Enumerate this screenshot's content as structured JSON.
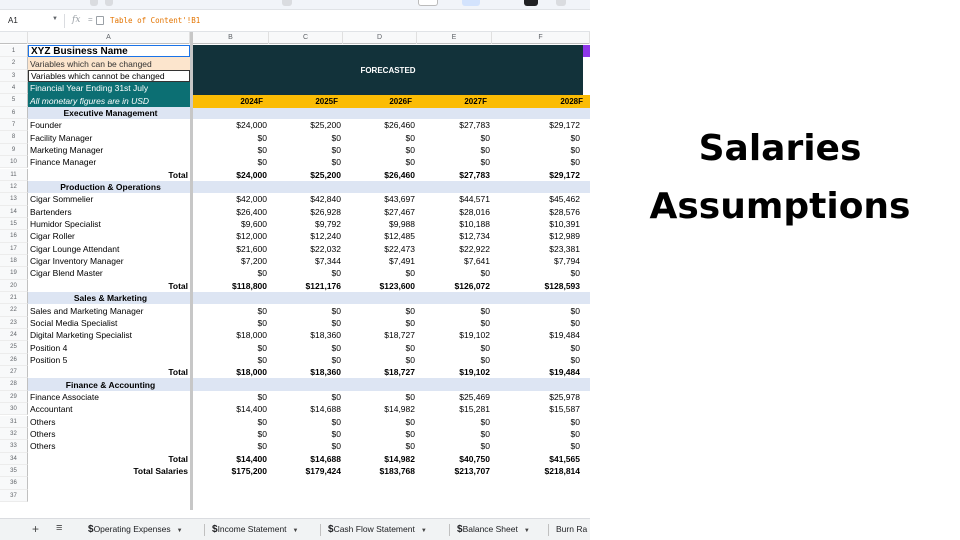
{
  "slide": {
    "title_line1": "Salaries",
    "title_line2": "Assumptions"
  },
  "formula_bar": {
    "cell_ref": "A1",
    "formula": "Table of Content'!B1"
  },
  "columns": [
    "A",
    "B",
    "C",
    "D",
    "E",
    "F"
  ],
  "header_block": {
    "forecast_label": "FORECASTED",
    "years": [
      "2024F",
      "2025F",
      "2026F",
      "2027F",
      "2028F"
    ]
  },
  "rows": [
    {
      "n": "1",
      "a": "XYZ Business Name",
      "style": "title"
    },
    {
      "n": "2",
      "a": "Variables which can be changed",
      "style": "peach"
    },
    {
      "n": "3",
      "a": "Variables which cannot be changed",
      "style": "white-box"
    },
    {
      "n": "4",
      "a": "Financial Year Ending 31st July",
      "style": "teal"
    },
    {
      "n": "5",
      "a": "All monetary figures are in USD",
      "style": "teal-italic"
    },
    {
      "n": "6",
      "a": "Executive Management",
      "style": "section"
    },
    {
      "n": "7",
      "a": "Founder",
      "v": [
        "$24,000",
        "$25,200",
        "$26,460",
        "$27,783",
        "$29,172"
      ]
    },
    {
      "n": "8",
      "a": "Facility Manager",
      "v": [
        "$0",
        "$0",
        "$0",
        "$0",
        "$0"
      ]
    },
    {
      "n": "9",
      "a": "Marketing Manager",
      "v": [
        "$0",
        "$0",
        "$0",
        "$0",
        "$0"
      ]
    },
    {
      "n": "10",
      "a": "Finance Manager",
      "v": [
        "$0",
        "$0",
        "$0",
        "$0",
        "$0"
      ]
    },
    {
      "n": "11",
      "a": "Total",
      "style": "total",
      "v": [
        "$24,000",
        "$25,200",
        "$26,460",
        "$27,783",
        "$29,172"
      ]
    },
    {
      "n": "12",
      "a": "Production & Operations",
      "style": "section"
    },
    {
      "n": "13",
      "a": "Cigar Sommelier",
      "v": [
        "$42,000",
        "$42,840",
        "$43,697",
        "$44,571",
        "$45,462"
      ]
    },
    {
      "n": "14",
      "a": "Bartenders",
      "v": [
        "$26,400",
        "$26,928",
        "$27,467",
        "$28,016",
        "$28,576"
      ]
    },
    {
      "n": "15",
      "a": "Humidor Specialist",
      "v": [
        "$9,600",
        "$9,792",
        "$9,988",
        "$10,188",
        "$10,391"
      ]
    },
    {
      "n": "16",
      "a": "Cigar Roller",
      "v": [
        "$12,000",
        "$12,240",
        "$12,485",
        "$12,734",
        "$12,989"
      ]
    },
    {
      "n": "17",
      "a": "Cigar Lounge Attendant",
      "v": [
        "$21,600",
        "$22,032",
        "$22,473",
        "$22,922",
        "$23,381"
      ]
    },
    {
      "n": "18",
      "a": "Cigar Inventory Manager",
      "v": [
        "$7,200",
        "$7,344",
        "$7,491",
        "$7,641",
        "$7,794"
      ]
    },
    {
      "n": "19",
      "a": "Cigar Blend Master",
      "v": [
        "$0",
        "$0",
        "$0",
        "$0",
        "$0"
      ]
    },
    {
      "n": "20",
      "a": "Total",
      "style": "total",
      "v": [
        "$118,800",
        "$121,176",
        "$123,600",
        "$126,072",
        "$128,593"
      ]
    },
    {
      "n": "21",
      "a": "Sales & Marketing",
      "style": "section"
    },
    {
      "n": "22",
      "a": "Sales and Marketing Manager",
      "v": [
        "$0",
        "$0",
        "$0",
        "$0",
        "$0"
      ]
    },
    {
      "n": "23",
      "a": "Social Media Specialist",
      "v": [
        "$0",
        "$0",
        "$0",
        "$0",
        "$0"
      ]
    },
    {
      "n": "24",
      "a": "Digital Marketing Specialist",
      "v": [
        "$18,000",
        "$18,360",
        "$18,727",
        "$19,102",
        "$19,484"
      ]
    },
    {
      "n": "25",
      "a": "Position 4",
      "v": [
        "$0",
        "$0",
        "$0",
        "$0",
        "$0"
      ]
    },
    {
      "n": "26",
      "a": "Position 5",
      "v": [
        "$0",
        "$0",
        "$0",
        "$0",
        "$0"
      ]
    },
    {
      "n": "27",
      "a": "Total",
      "style": "total",
      "v": [
        "$18,000",
        "$18,360",
        "$18,727",
        "$19,102",
        "$19,484"
      ]
    },
    {
      "n": "28",
      "a": "Finance & Accounting",
      "style": "section"
    },
    {
      "n": "29",
      "a": "Finance Associate",
      "v": [
        "$0",
        "$0",
        "$0",
        "$25,469",
        "$25,978"
      ]
    },
    {
      "n": "30",
      "a": "Accountant",
      "v": [
        "$14,400",
        "$14,688",
        "$14,982",
        "$15,281",
        "$15,587"
      ]
    },
    {
      "n": "31",
      "a": "Others",
      "v": [
        "$0",
        "$0",
        "$0",
        "$0",
        "$0"
      ]
    },
    {
      "n": "32",
      "a": "Others",
      "v": [
        "$0",
        "$0",
        "$0",
        "$0",
        "$0"
      ]
    },
    {
      "n": "33",
      "a": "Others",
      "v": [
        "$0",
        "$0",
        "$0",
        "$0",
        "$0"
      ]
    },
    {
      "n": "34",
      "a": "Total",
      "style": "total",
      "v": [
        "$14,400",
        "$14,688",
        "$14,982",
        "$40,750",
        "$41,565"
      ]
    },
    {
      "n": "35",
      "a": "Total Salaries",
      "style": "total",
      "v": [
        "$175,200",
        "$179,424",
        "$183,768",
        "$213,707",
        "$218,814"
      ]
    },
    {
      "n": "36",
      "a": ""
    },
    {
      "n": "37",
      "a": ""
    }
  ],
  "sheet_tabs": [
    "Operating Expenses",
    "Income Statement",
    "Cash Flow Statement",
    "Balance Sheet",
    "Burn Ra"
  ],
  "colors": {
    "navy": "#12323a",
    "teal": "#0c6f73",
    "amber": "#fbbc04",
    "section": "#dde5f3",
    "peach": "#fce5cd"
  }
}
